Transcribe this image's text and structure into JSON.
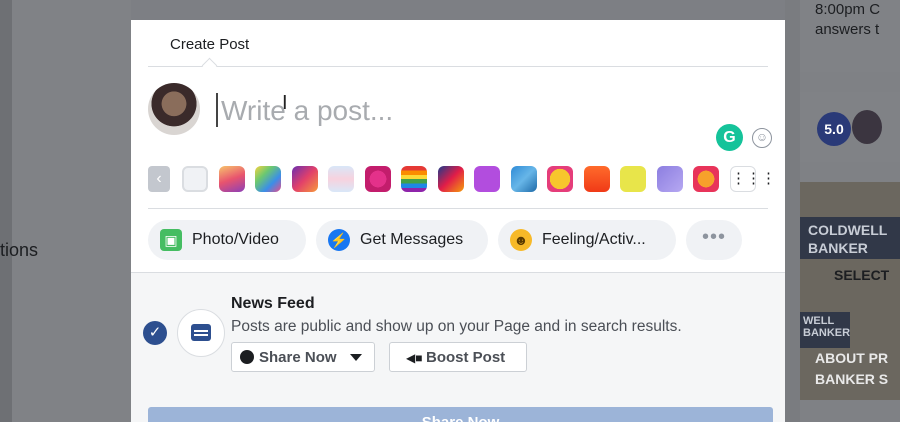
{
  "background": {
    "left_text": "tions",
    "right_text": "8:00pm C\nanswers t",
    "rating": "5.0",
    "ad": {
      "logo_text": "COLDWELL BANKER",
      "select_text": "SELECT",
      "logo2_text": "WELL BANKER",
      "caption_line1": "ABOUT PR",
      "caption_line2": "BANKER S"
    }
  },
  "modal": {
    "title": "Create Post",
    "composer": {
      "placeholder": "Write a post...",
      "grammarly_letter": "G",
      "emoji_glyph": "☺"
    },
    "backgrounds": {
      "prev_glyph": "‹",
      "grid_glyph": "⋮⋮⋮",
      "swatches": [
        {
          "name": "swatch-plain",
          "fill": "#f0f2f5"
        },
        {
          "name": "swatch-sunset",
          "fill": "linear-gradient(160deg,#f7c46c,#e8546e,#8b3fb8)"
        },
        {
          "name": "swatch-rainbow",
          "fill": "linear-gradient(135deg,#f5d33f,#6cc870,#3b8ee8,#e84e8a)"
        },
        {
          "name": "swatch-purple-orange",
          "fill": "linear-gradient(135deg,#6a2fb0,#e2406a,#f69a3c)"
        },
        {
          "name": "swatch-pastel",
          "fill": "linear-gradient(180deg,#d9e7f8,#f7d2de,#d9e7f8)"
        },
        {
          "name": "swatch-heart",
          "fill": "radial-gradient(circle,#e4318a 45%,#c31d6c 46%)"
        },
        {
          "name": "swatch-pride",
          "fill": "linear-gradient(180deg,#e53935 0 17%,#fb8c00 17% 34%,#fdd835 34% 50%,#43a047 50% 67%,#1e88e5 67% 84%,#8e24aa 84%)"
        },
        {
          "name": "swatch-colorful",
          "fill": "linear-gradient(135deg,#1e3a8a,#e11d48,#f59e0b)"
        },
        {
          "name": "swatch-violet",
          "fill": "#b24dde"
        },
        {
          "name": "swatch-blue-pattern",
          "fill": "linear-gradient(135deg,#2f8bd6,#67b6e8,#1e6aa8)"
        },
        {
          "name": "swatch-heart-eyes",
          "fill": "radial-gradient(circle,#f7c72c 55%,#e53d7a 56%)"
        },
        {
          "name": "swatch-fire",
          "fill": "linear-gradient(180deg,#ff6b2b,#f03a17)"
        },
        {
          "name": "swatch-yellow-char",
          "fill": "#e8e54a"
        },
        {
          "name": "swatch-lavender",
          "fill": "linear-gradient(135deg,#8c7ee0,#b6a8f2)"
        },
        {
          "name": "swatch-orange-dot",
          "fill": "radial-gradient(circle,#f7a12b 45%,#e8345a 46%)"
        }
      ]
    },
    "actions": {
      "photo": "Photo/Video",
      "messages": "Get Messages",
      "feeling": "Feeling/Activ...",
      "more": "•••"
    },
    "audience": {
      "checked": true,
      "title": "News Feed",
      "description": "Posts are public and show up on your Page and in search results.",
      "share_option": "Share Now",
      "boost_label": "Boost Post",
      "submit_label": "Share Now"
    }
  }
}
